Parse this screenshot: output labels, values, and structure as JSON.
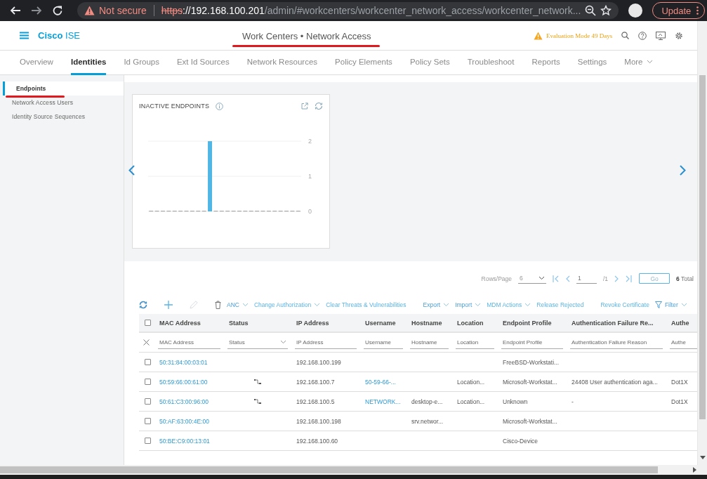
{
  "browser": {
    "security_label": "Not secure",
    "url_scheme": "https",
    "url_host": "://192.168.100.201",
    "url_path": "/admin/#workcenters/workcenter_network_access/workcenter_network...",
    "update_button": "Update"
  },
  "app": {
    "brand": "Cisco",
    "product": "ISE",
    "title": "Work Centers • Network Access",
    "title_underlined": true,
    "license_notice": "Evaluation Mode 49 Days"
  },
  "tabs": [
    {
      "label": "Overview",
      "selected": false
    },
    {
      "label": "Identities",
      "selected": true
    },
    {
      "label": "Id Groups",
      "selected": false
    },
    {
      "label": "Ext Id Sources",
      "selected": false
    },
    {
      "label": "Network Resources",
      "selected": false
    },
    {
      "label": "Policy Elements",
      "selected": false
    },
    {
      "label": "Policy Sets",
      "selected": false
    },
    {
      "label": "Troubleshoot",
      "selected": false
    },
    {
      "label": "Reports",
      "selected": false
    },
    {
      "label": "Settings",
      "selected": false
    },
    {
      "label": "More",
      "selected": false,
      "kind": "menu"
    }
  ],
  "sidebar": {
    "items": [
      {
        "label": "Endpoints",
        "selected": true,
        "underlined": true
      },
      {
        "label": "Network Access Users",
        "selected": false,
        "underlined": false
      },
      {
        "label": "Identity Source Sequences",
        "selected": false,
        "underlined": false
      }
    ]
  },
  "dashlet": {
    "title": "INACTIVE ENDPOINTS",
    "chart_data": {
      "type": "bar",
      "values": [
        0,
        0,
        0,
        0,
        0,
        0,
        0,
        0,
        0,
        0,
        2,
        0,
        0,
        0,
        0,
        0,
        0,
        0,
        0,
        0,
        0,
        0,
        0,
        0,
        0,
        0
      ],
      "ylim": [
        0,
        2
      ],
      "yticks": [
        0,
        1,
        2
      ]
    }
  },
  "pagination": {
    "rows_label": "Rows/Page",
    "rows_per_page": "6",
    "page": "1",
    "page_count": "/1",
    "go_button": "Go",
    "total_count": "6",
    "total_label": "Total"
  },
  "toolbar": {
    "edit_disabled": true,
    "actions": [
      {
        "label": "ANC",
        "kind": "dropdown"
      },
      {
        "label": "Change Authorization",
        "kind": "dropdown"
      },
      {
        "label": "Clear Threats & Vulnerabilities",
        "kind": "action"
      },
      {
        "label": "Export",
        "kind": "dropdown"
      },
      {
        "label": "Import",
        "kind": "dropdown"
      },
      {
        "label": "MDM Actions",
        "kind": "dropdown"
      },
      {
        "label": "Release Rejected",
        "kind": "action"
      },
      {
        "label": "Revoke Certificate",
        "kind": "action"
      },
      {
        "label": "Filter",
        "kind": "filter"
      }
    ]
  },
  "table": {
    "select_all_checked": false,
    "columns": [
      "MAC Address",
      "Status",
      "IP Address",
      "Username",
      "Hostname",
      "Location",
      "Endpoint Profile",
      "Authentication Failure Re...",
      "Authe"
    ],
    "filters": [
      {
        "placeholder": "MAC Address",
        "kind": "text"
      },
      {
        "placeholder": "Status",
        "kind": "select"
      },
      {
        "placeholder": "IP Address",
        "kind": "text"
      },
      {
        "placeholder": "Username",
        "kind": "text"
      },
      {
        "placeholder": "Hostname",
        "kind": "text"
      },
      {
        "placeholder": "Location",
        "kind": "text"
      },
      {
        "placeholder": "Endpoint Profile",
        "kind": "text"
      },
      {
        "placeholder": "Authentication Failure Reason",
        "kind": "text"
      },
      {
        "placeholder": "Authe",
        "kind": "text"
      }
    ],
    "rows": [
      {
        "checked": false,
        "mac": "50:31:84:00:03:01",
        "connected": false,
        "ip": "192.168.100.199",
        "profile": "FreeBSD-Workstati..."
      },
      {
        "checked": false,
        "mac": "50:59:66:00:61:00",
        "connected": true,
        "ip": "192.168.100.7",
        "username": "50-59-66-...",
        "location": "Location...",
        "profile": "Microsoft-Workstat...",
        "failure_reason": "24408 User authentication aga...",
        "auth": "Dot1X"
      },
      {
        "checked": false,
        "mac": "50:61:C3:00:96:00",
        "connected": true,
        "ip": "192.168.100.5",
        "username": "NETWORK...",
        "hostname": "desktop-e...",
        "location": "Location...",
        "profile": "Unknown",
        "failure_reason": "-",
        "auth": "Dot1X"
      },
      {
        "checked": false,
        "mac": "50:AF:63:00:4E:00",
        "connected": false,
        "ip": "192.168.100.198",
        "hostname": "srv.networ...",
        "profile": "Microsoft-Workstat..."
      },
      {
        "checked": false,
        "mac": "50:BE:C9:00:13:01",
        "connected": false,
        "ip": "192.168.100.60",
        "profile": "Cisco-Device"
      }
    ]
  }
}
